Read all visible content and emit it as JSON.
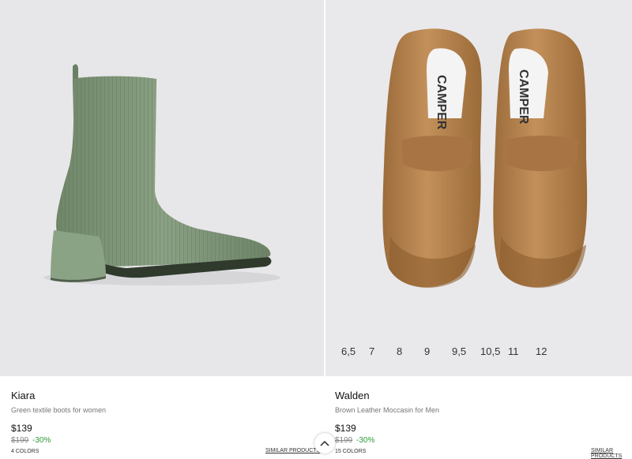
{
  "products": [
    {
      "name": "Kiara",
      "description": "Green textile boots for women",
      "price": "$139",
      "original_price": "$199",
      "discount": "-30%",
      "colors": "4 COLORS",
      "similar": "SIMILAR PRODUCTS"
    },
    {
      "name": "Walden",
      "description": "Brown Leather Moccasin for Men",
      "price": "$139",
      "original_price": "$199",
      "discount": "-30%",
      "colors": "15 COLORS",
      "similar": "SIMILAR PRODUCTS",
      "sizes": [
        "6,5",
        "7",
        "8",
        "9",
        "9,5",
        "10,5",
        "11",
        "12"
      ],
      "brand_on_insole": "CAMPER"
    }
  ],
  "icons": {
    "scroll_top": "chevron-up-icon"
  },
  "colors": {
    "discount": "#2f9a3a",
    "boot": "#7d9378",
    "loafer": "#b8844f"
  }
}
